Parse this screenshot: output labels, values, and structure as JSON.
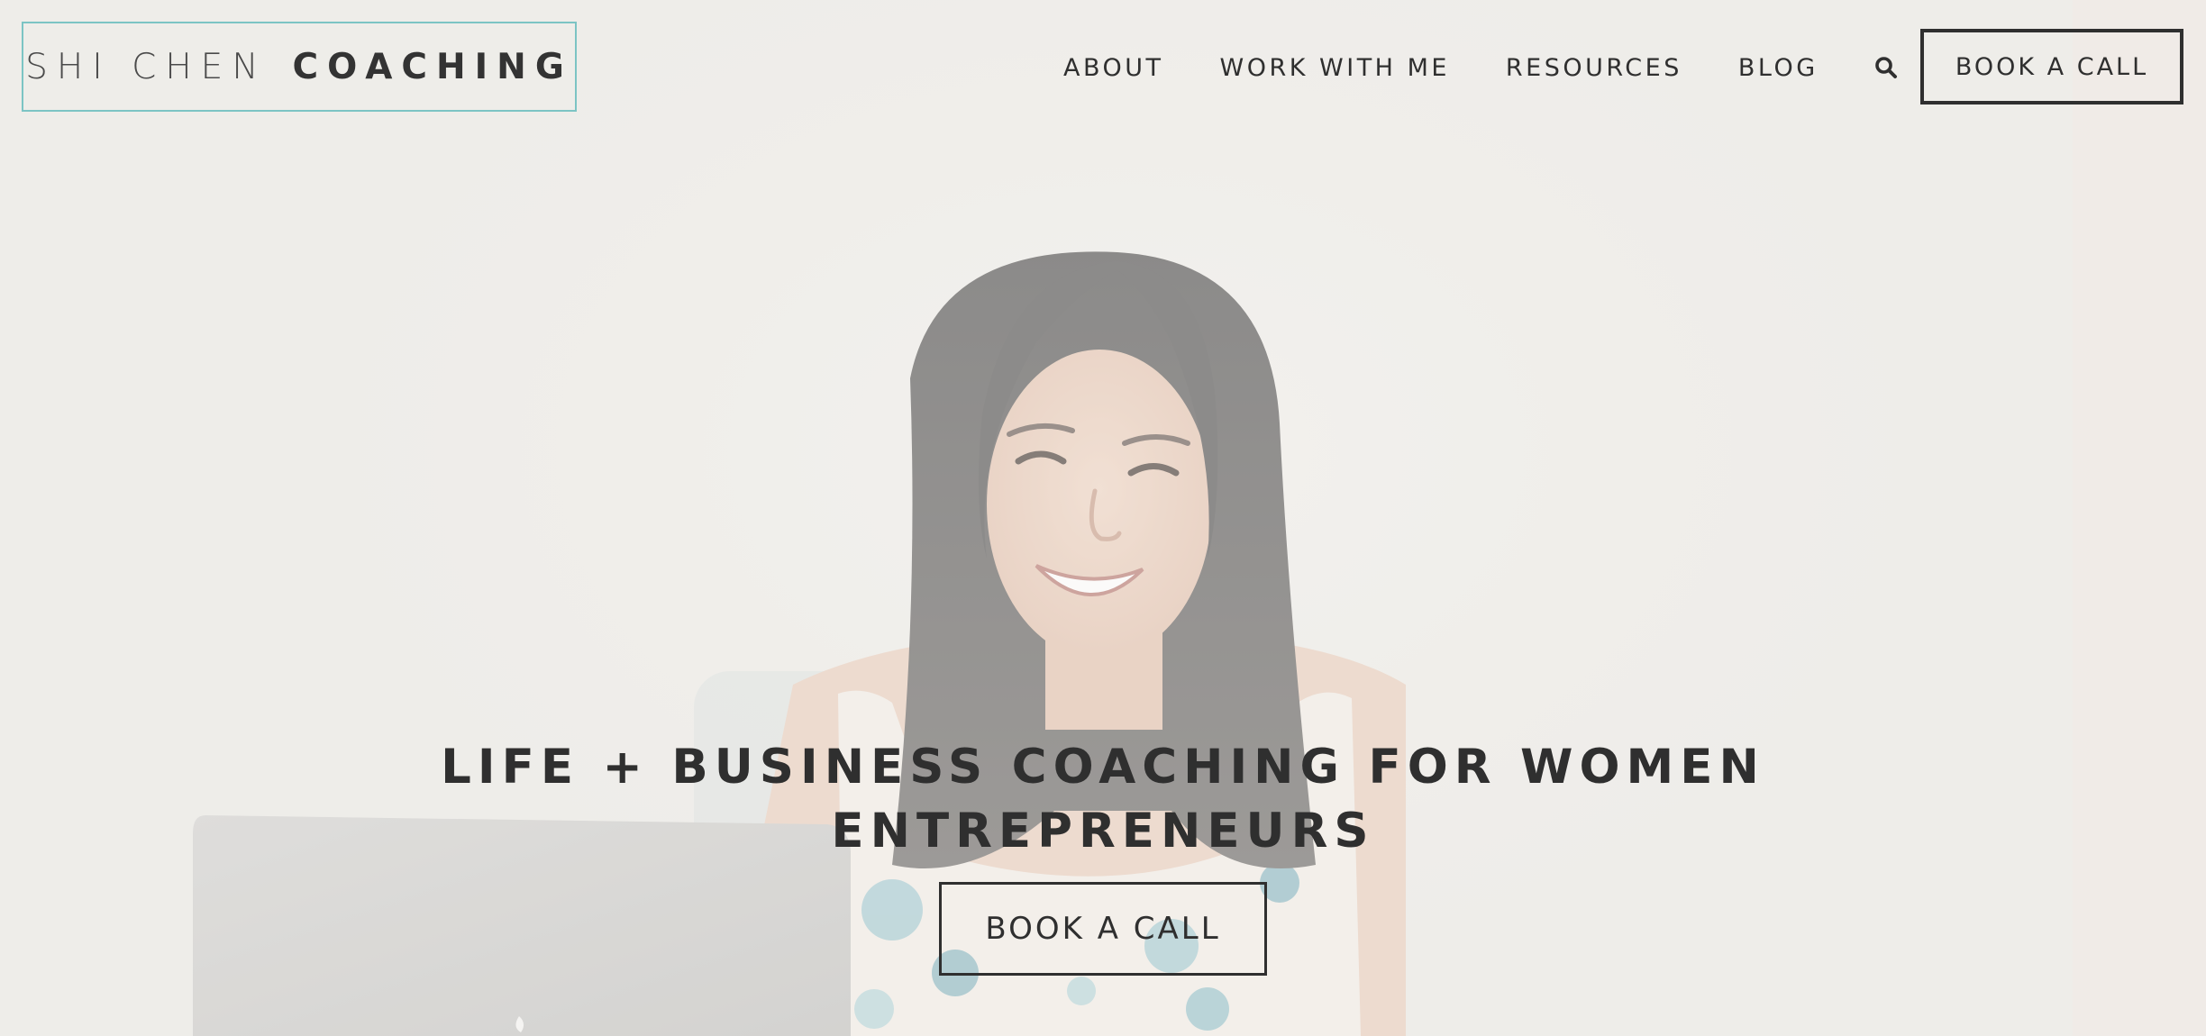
{
  "brand": {
    "name_light": "SHI CHEN",
    "name_bold": "COACHING",
    "border_color": "#7cc4c4"
  },
  "nav": {
    "items": [
      {
        "label": "ABOUT"
      },
      {
        "label": "WORK WITH ME"
      },
      {
        "label": "RESOURCES"
      },
      {
        "label": "BLOG"
      }
    ],
    "search_icon": "search-icon",
    "cta_label": "BOOK A CALL"
  },
  "hero": {
    "title_line1": "LIFE + BUSINESS COACHING FOR WOMEN",
    "title_line2": "ENTREPRENEURS",
    "cta_label": "BOOK A CALL"
  },
  "colors": {
    "text": "#2f2f2f",
    "background": "#efeeea",
    "accent": "#7cc4c4"
  }
}
